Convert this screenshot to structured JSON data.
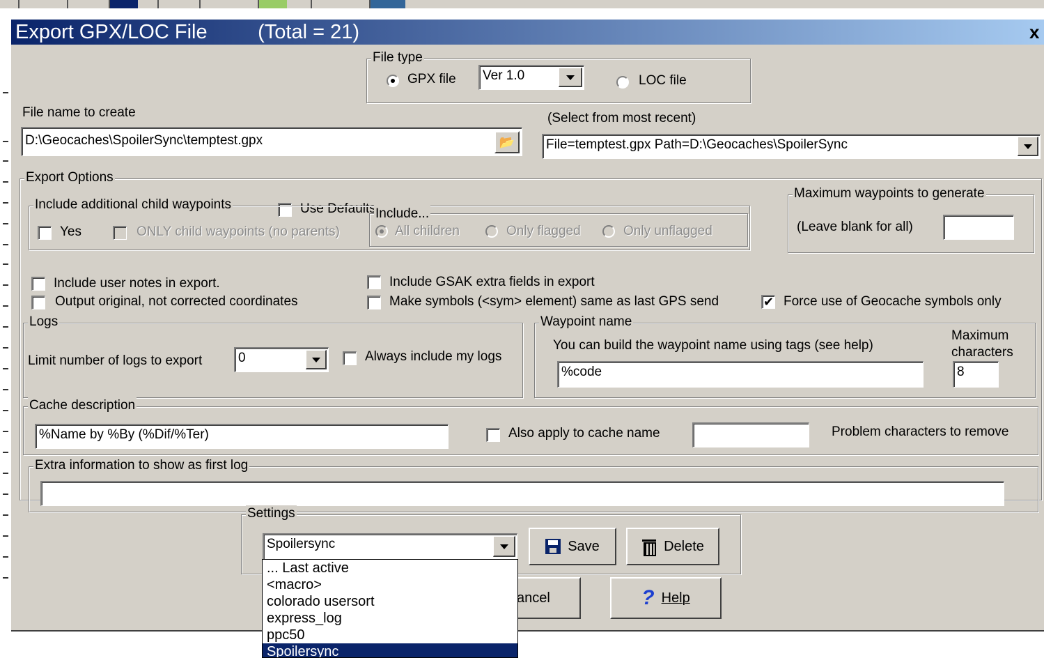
{
  "dialog": {
    "title": "Export GPX/LOC File         (Total = 21)",
    "close_glyph": "x"
  },
  "file_type": {
    "legend": "File type",
    "gpx_label": "GPX file",
    "gpx_selected": true,
    "version_value": "Ver 1.0",
    "loc_label": "LOC file",
    "loc_selected": false
  },
  "file_name": {
    "label": "File name to create",
    "value": "D:\\Geocaches\\SpoilerSync\\temptest.gpx",
    "browse_icon": "open-folder-icon"
  },
  "recent": {
    "label": "(Select from most recent)",
    "value": "File=temptest.gpx Path=D:\\Geocaches\\SpoilerSync"
  },
  "export_options": {
    "legend": "Export Options",
    "use_defaults_label": "Use Defaults",
    "use_defaults": false,
    "child_waypoints": {
      "legend": "Include additional child waypoints",
      "yes_label": "Yes",
      "only_child_label": "ONLY child waypoints (no parents)"
    },
    "include": {
      "legend": "Include...",
      "all_children": "All children",
      "only_flagged": "Only flagged",
      "only_unflagged": "Only unflagged"
    },
    "max_waypoints": {
      "legend": "Maximum waypoints to generate",
      "hint": "(Leave blank for all)",
      "value": ""
    },
    "user_notes_label": "Include user notes in export.",
    "original_coords_label": "Output original, not corrected coordinates",
    "gsak_extra_label": "Include GSAK extra fields in export",
    "symbols_label": "Make symbols (<sym> element) same as last GPS send",
    "force_symbols_label": "Force use of Geocache symbols only",
    "force_symbols": true
  },
  "logs": {
    "legend": "Logs",
    "limit_label": "Limit number of logs to export",
    "limit_value": "0",
    "always_mine_label": "Always include my logs"
  },
  "waypoint_name": {
    "legend": "Waypoint name",
    "hint": "You can build the waypoint name using tags (see help)",
    "value": "%code",
    "max_label_1": "Maximum",
    "max_label_2": "characters",
    "max_value": "8"
  },
  "cache_description": {
    "legend": "Cache description",
    "value": "%Name by %By (%Dif/%Ter)",
    "also_apply_label": "Also apply to cache name",
    "problem_chars_value": "",
    "problem_chars_label": "Problem characters to remove"
  },
  "extra_info": {
    "legend": "Extra information to show as first log",
    "value": ""
  },
  "settings": {
    "legend": "Settings",
    "value": "Spoilersync",
    "save_label": "Save",
    "delete_label": "Delete",
    "options": [
      "... Last active",
      "<macro>",
      "colorado usersort",
      "express_log",
      "ppc50",
      "Spoilersync"
    ],
    "selected_index": 5
  },
  "buttons": {
    "cancel_label": "ancel",
    "help_label": "Help"
  }
}
